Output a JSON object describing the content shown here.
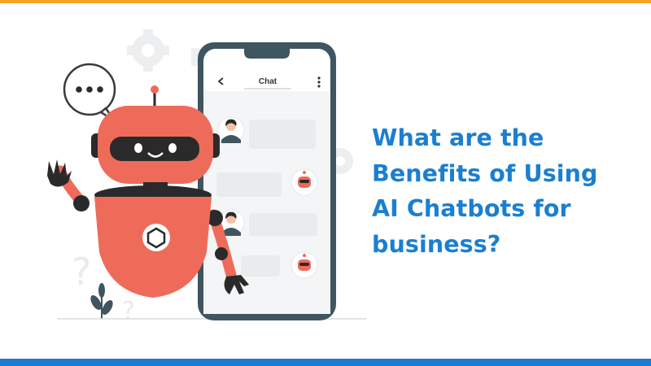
{
  "colors": {
    "accent_top": "#f5a623",
    "accent_bottom": "#1d7bd1",
    "headline": "#1b7fd0",
    "robot": "#ee6b5a",
    "robot_dark": "#2a2a2a",
    "phone_frame": "#3f5560"
  },
  "phone": {
    "header_title": "Chat"
  },
  "headline": {
    "lines": [
      "What are the",
      "Benefits of Using",
      "AI Chatbots for",
      "business?"
    ]
  },
  "icons": [
    "back-arrow-icon",
    "more-vert-icon",
    "gear-icon",
    "question-mark-icon",
    "ellipsis-bubble-icon"
  ]
}
